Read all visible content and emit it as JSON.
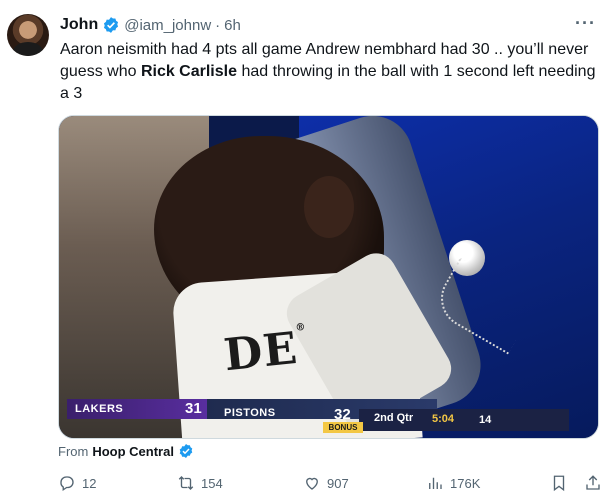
{
  "author": {
    "name": "John",
    "handle": "@iam_johnw",
    "separator": "·",
    "time": "6h",
    "verified": true
  },
  "tweet": {
    "text_before": "Aaron neismith had 4 pts all game Andrew nembhard had 30 .. you’ll never guess who ",
    "text_bold": "Rick Carlisle",
    "text_after": " had throwing in the ball with 1 second left needing a 3"
  },
  "media": {
    "towel_logo": "DE",
    "towel_logo_mark": "®",
    "scoreboard": {
      "team_home": "LAKERS",
      "score_home": "31",
      "team_away": "PISTONS",
      "score_away": "32",
      "bonus": "BONUS",
      "period": "2nd Qtr",
      "clock": "5:04",
      "shot_clock": "14"
    }
  },
  "source": {
    "prefix": "From",
    "name": "Hoop Central"
  },
  "actions": {
    "replies": "12",
    "reposts": "154",
    "likes": "907",
    "views": "176K"
  },
  "colors": {
    "verified_blue": "#1d9bf0",
    "muted_text": "#536471",
    "primary_text": "#0f1419"
  },
  "icons": {
    "more": "more-options-icon",
    "reply": "reply-icon",
    "repost": "repost-icon",
    "like": "heart-icon",
    "views": "views-icon",
    "bookmark": "bookmark-icon",
    "share": "share-icon"
  }
}
